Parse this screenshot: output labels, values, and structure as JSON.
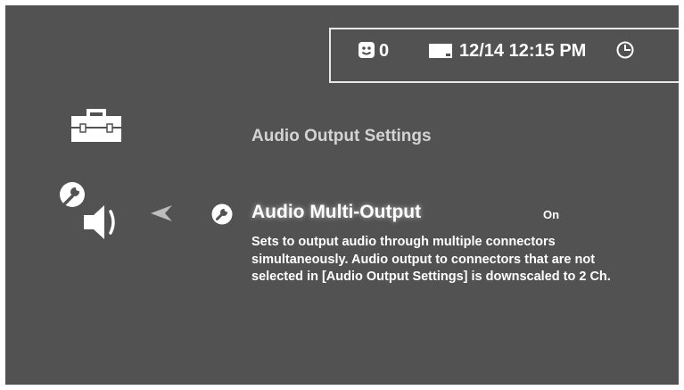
{
  "status": {
    "notification_count": "0",
    "datetime": "12/14 12:15 PM"
  },
  "icons": {
    "toolbox": "toolbox-icon",
    "setting": "wrench-speaker-icon",
    "arrow": "arrow-left-icon",
    "item": "wrench-icon",
    "notification": "notification-icon",
    "card": "card-icon",
    "clock": "clock-icon"
  },
  "section": {
    "title": "Audio Output Settings"
  },
  "item": {
    "title": "Audio Multi-Output",
    "value": "On",
    "description": "Sets to output audio through multiple connectors simultaneously. Audio output to connectors that are not selected in [Audio Output Settings] is downscaled to 2 Ch."
  },
  "colors": {
    "background": "#525252",
    "text": "#ffffff",
    "muted_text": "#d3d3d3"
  }
}
